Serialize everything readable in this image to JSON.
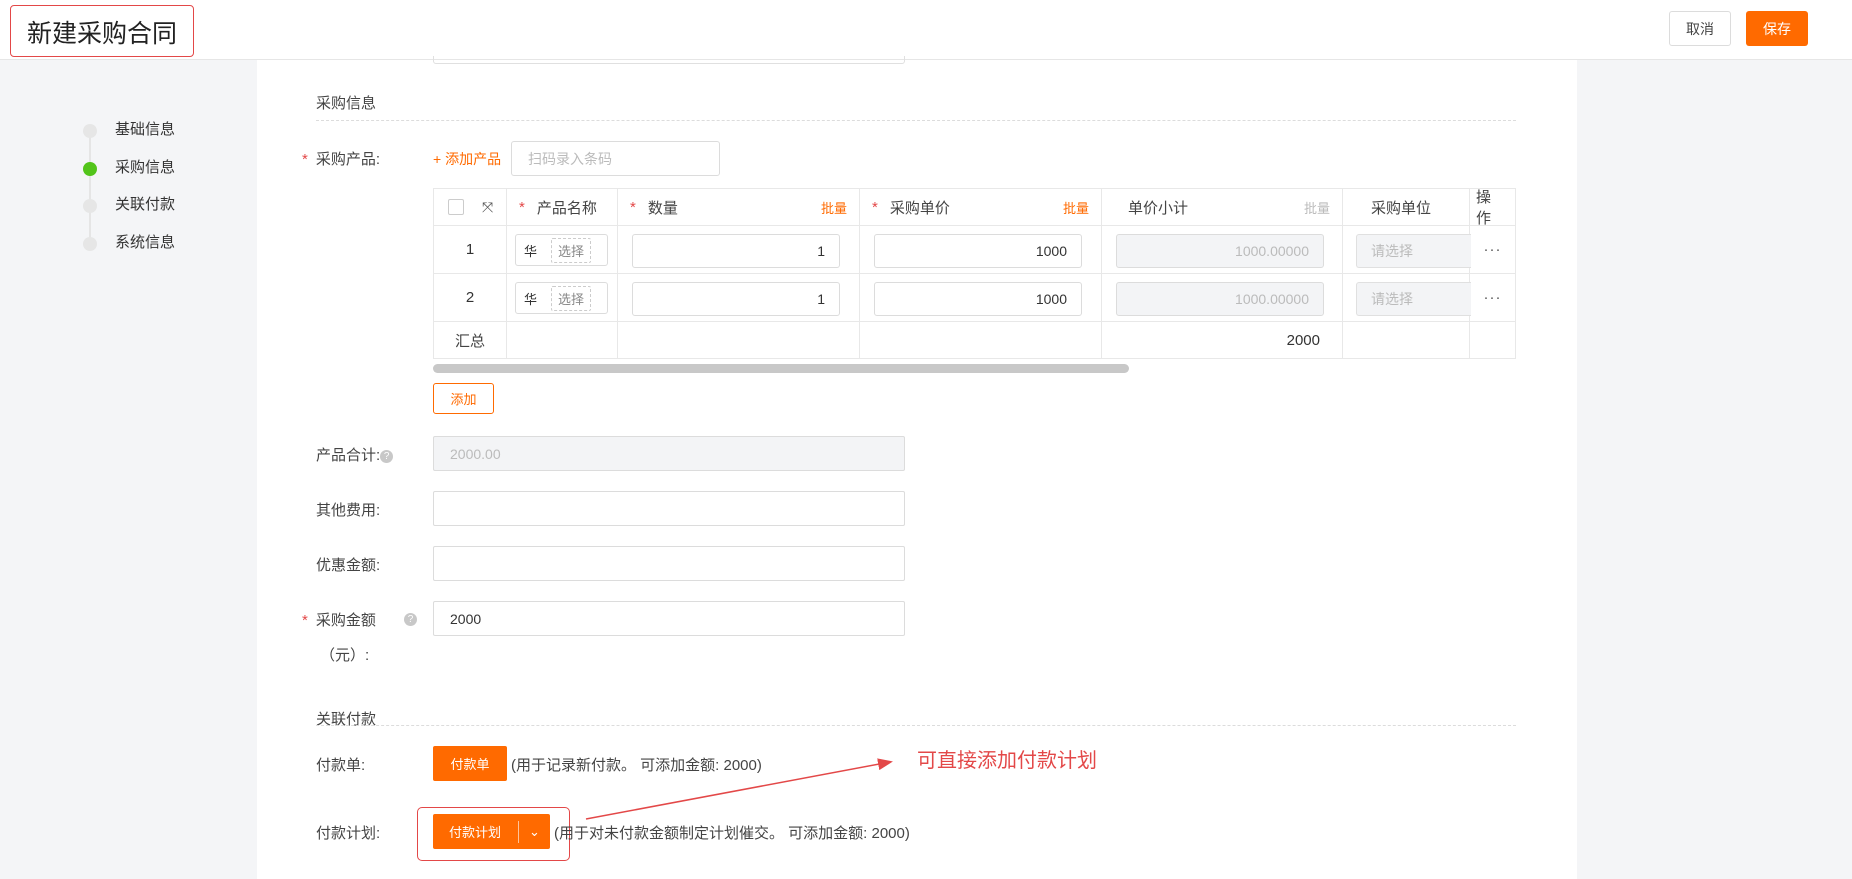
{
  "header": {
    "title": "新建采购合同",
    "cancel_label": "取消",
    "save_label": "保存"
  },
  "steps": [
    {
      "label": "基础信息",
      "active": false
    },
    {
      "label": "采购信息",
      "active": true
    },
    {
      "label": "关联付款",
      "active": false
    },
    {
      "label": "系统信息",
      "active": false
    }
  ],
  "purchase": {
    "section_title": "采购信息",
    "product_label": "采购产品:",
    "add_product": "+ 添加产品",
    "scan_placeholder": "扫码录入条码",
    "table": {
      "headers": {
        "name": "产品名称",
        "qty": "数量",
        "price": "采购单价",
        "subtotal": "单价小计",
        "unit": "采购单位",
        "ops": "操作",
        "batch": "批量"
      },
      "rows": [
        {
          "index": "1",
          "name_char": "华",
          "pick": "选择",
          "qty": "1",
          "price": "1000",
          "subtotal": "1000.00000",
          "unit_placeholder": "请选择",
          "more": "···"
        },
        {
          "index": "2",
          "name_char": "华",
          "pick": "选择",
          "qty": "1",
          "price": "1000",
          "subtotal": "1000.00000",
          "unit_placeholder": "请选择",
          "more": "···"
        }
      ],
      "summary": {
        "label": "汇总",
        "total": "2000"
      }
    },
    "add_row_label": "添加",
    "product_total_label": "产品合计:",
    "product_total_value": "2000.00",
    "other_fee_label": "其他费用:",
    "discount_label": "优惠金额:",
    "purchase_amount_label": "采购金额",
    "purchase_amount_unit": "（元）:",
    "purchase_amount_value": "2000",
    "help": "?"
  },
  "payment": {
    "section_title": "关联付款",
    "order_label": "付款单:",
    "order_button": "付款单",
    "order_hint": "(用于记录新付款。 可添加金额: 2000)",
    "plan_label": "付款计划:",
    "plan_button": "付款计划",
    "plan_hint": "(用于对未付款金额制定计划催交。 可添加金额: 2000)"
  },
  "annotation": {
    "text": "可直接添加付款计划",
    "color": "#e34848"
  },
  "colors": {
    "accent": "#ff6a00",
    "active_step": "#52c41a",
    "annotation": "#e34848"
  }
}
